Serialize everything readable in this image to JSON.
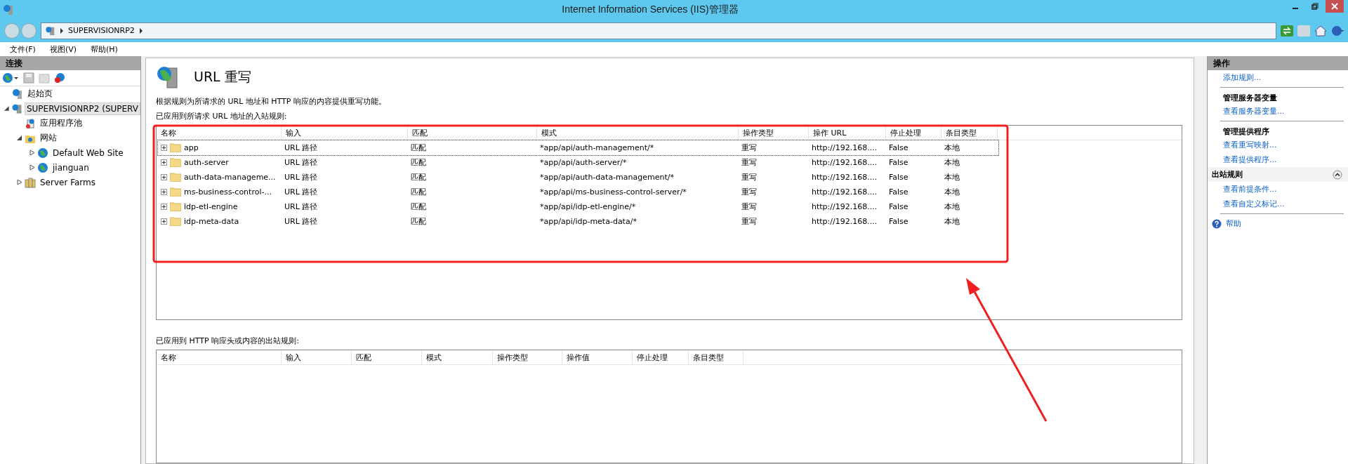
{
  "window": {
    "title": "Internet Information Services (IIS)管理器"
  },
  "address_bar": {
    "segments": [
      "SUPERVISIONRP2"
    ]
  },
  "menu": [
    "文件(F)",
    "视图(V)",
    "帮助(H)"
  ],
  "connections": {
    "title": "连接",
    "tree": [
      {
        "label": "起始页",
        "kind": "start",
        "selected": false
      },
      {
        "label": "SUPERVISIONRP2 (SUPERV",
        "kind": "server",
        "selected": true,
        "expanded": true,
        "children": [
          {
            "label": "应用程序池",
            "kind": "pool",
            "selected": false
          },
          {
            "label": "网站",
            "kind": "sites",
            "selected": false,
            "expanded": true,
            "children": [
              {
                "label": "Default Web Site",
                "kind": "site",
                "selected": false,
                "expanded": false
              },
              {
                "label": "jianguan",
                "kind": "site",
                "selected": false,
                "expanded": false
              }
            ]
          },
          {
            "label": "Server Farms",
            "kind": "farms",
            "selected": false,
            "expanded": false
          }
        ]
      }
    ]
  },
  "main": {
    "title": "URL 重写",
    "description": "根据规则为所请求的 URL 地址和 HTTP 响应的内容提供重写功能。",
    "inbound": {
      "label": "已应用到所请求 URL 地址的入站规则:",
      "columns": [
        "名称",
        "输入",
        "匹配",
        "模式",
        "操作类型",
        "操作 URL",
        "停止处理",
        "条目类型"
      ],
      "rows": [
        {
          "selected": true,
          "cells": [
            "app",
            "URL 路径",
            "匹配",
            "*app/api/auth-management/*",
            "重写",
            "http://192.168....",
            "False",
            "本地"
          ]
        },
        {
          "selected": false,
          "cells": [
            "auth-server",
            "URL 路径",
            "匹配",
            "*app/api/auth-server/*",
            "重写",
            "http://192.168....",
            "False",
            "本地"
          ]
        },
        {
          "selected": false,
          "cells": [
            "auth-data-manageme...",
            "URL 路径",
            "匹配",
            "*app/api/auth-data-management/*",
            "重写",
            "http://192.168....",
            "False",
            "本地"
          ]
        },
        {
          "selected": false,
          "cells": [
            "ms-business-control-...",
            "URL 路径",
            "匹配",
            "*app/api/ms-business-control-server/*",
            "重写",
            "http://192.168....",
            "False",
            "本地"
          ]
        },
        {
          "selected": false,
          "cells": [
            "idp-etl-engine",
            "URL 路径",
            "匹配",
            "*app/api/idp-etl-engine/*",
            "重写",
            "http://192.168....",
            "False",
            "本地"
          ]
        },
        {
          "selected": false,
          "cells": [
            "idp-meta-data",
            "URL 路径",
            "匹配",
            "*app/api/idp-meta-data/*",
            "重写",
            "http://192.168....",
            "False",
            "本地"
          ]
        }
      ]
    },
    "outbound": {
      "label": "已应用到 HTTP 响应头或内容的出站规则:",
      "columns": [
        "名称",
        "输入",
        "匹配",
        "模式",
        "操作类型",
        "操作值",
        "停止处理",
        "条目类型"
      ]
    }
  },
  "actions": {
    "title": "操作",
    "items": [
      {
        "kind": "link",
        "label": "添加规则..."
      },
      {
        "kind": "divider"
      },
      {
        "kind": "heading",
        "label": "管理服务器变量"
      },
      {
        "kind": "link",
        "label": "查看服务器变量..."
      },
      {
        "kind": "divider"
      },
      {
        "kind": "heading",
        "label": "管理提供程序"
      },
      {
        "kind": "link",
        "label": "查看重写映射..."
      },
      {
        "kind": "link",
        "label": "查看提供程序..."
      },
      {
        "kind": "section",
        "label": "出站规则",
        "expanded": true
      },
      {
        "kind": "link",
        "label": "查看前提条件..."
      },
      {
        "kind": "link",
        "label": "查看自定义标记..."
      },
      {
        "kind": "divider"
      },
      {
        "kind": "help",
        "label": "帮助"
      }
    ]
  }
}
